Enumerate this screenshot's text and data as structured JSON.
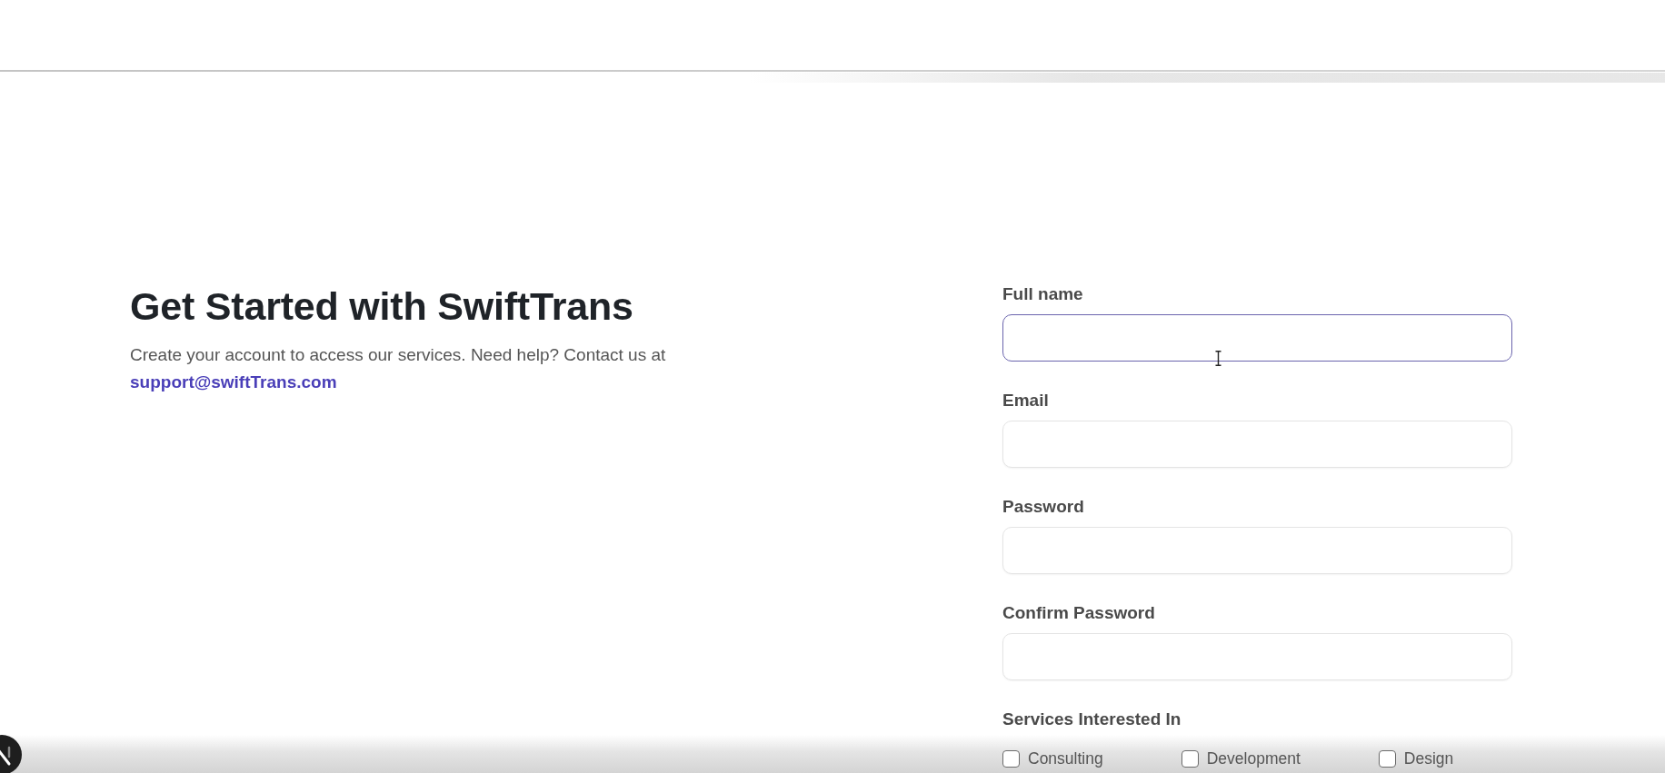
{
  "heading": "Get Started with SwiftTrans",
  "intro": {
    "text": "Create your account to access our services. Need help? Contact us at",
    "link": "support@swiftTrans.com"
  },
  "fields": [
    {
      "label": "Full name",
      "focused": true
    },
    {
      "label": "Email",
      "focused": false
    },
    {
      "label": "Password",
      "focused": false
    },
    {
      "label": "Confirm Password",
      "focused": false
    }
  ],
  "services": {
    "label": "Services Interested In",
    "options": [
      {
        "label": "Consulting",
        "checked": false
      },
      {
        "label": "Development",
        "checked": false
      },
      {
        "label": "Design",
        "checked": false
      }
    ]
  }
}
